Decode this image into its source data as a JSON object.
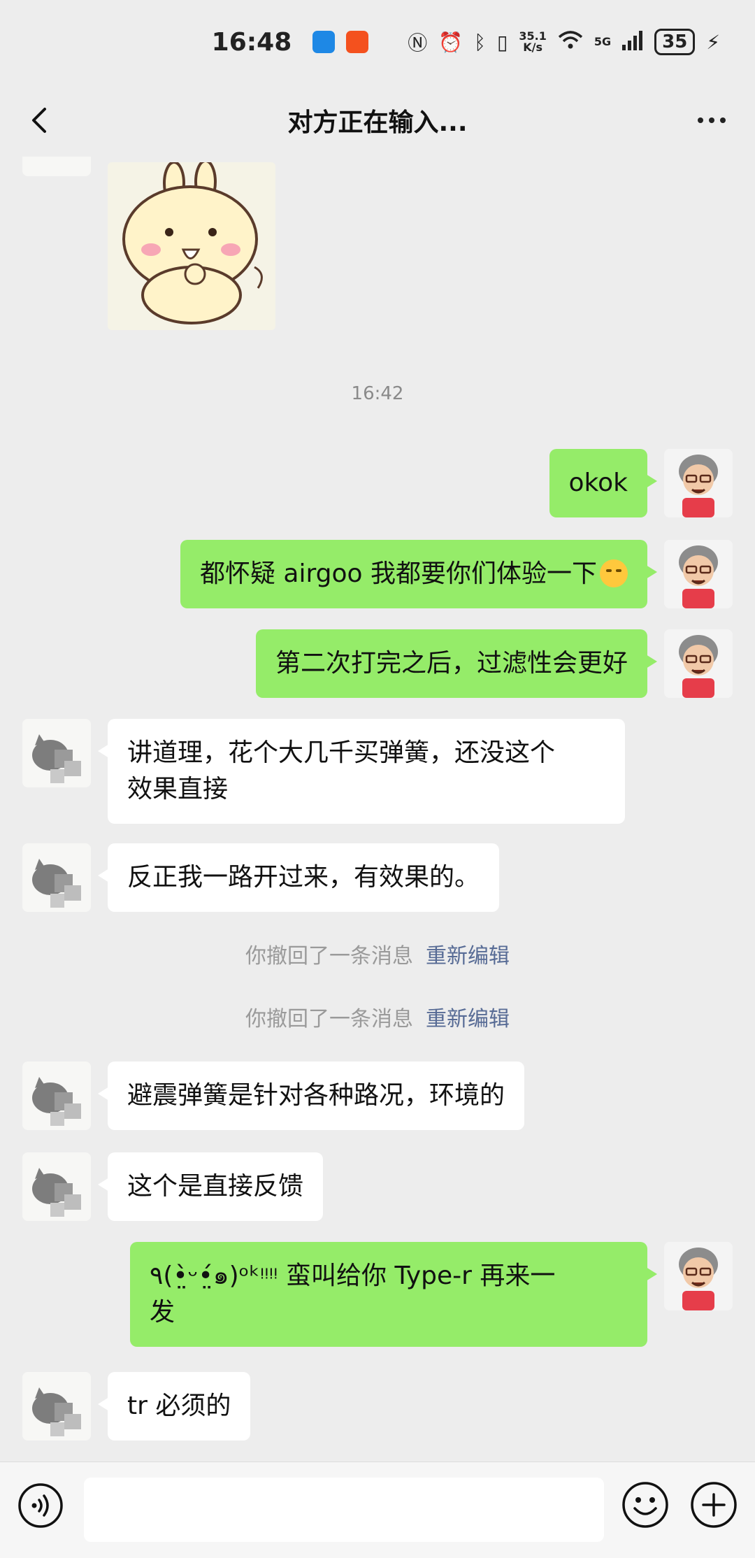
{
  "status_bar": {
    "time": "16:48",
    "net_speed_value": "35.1",
    "net_speed_unit": "K/s",
    "network": "5G",
    "battery": "35"
  },
  "nav": {
    "title": "对方正在输入..."
  },
  "messages": {
    "timestamp": "16:42",
    "m1": "okok",
    "m2": "都怀疑 airgoo 我都要你们体验一下",
    "m3": "第二次打完之后，过滤性会更好",
    "m4_line1": "讲道理，花个大几千买弹簧，还没这个",
    "m4_line2": "效果直接",
    "m5": "反正我一路开过来，有效果的。",
    "recall_text": "你撤回了一条消息",
    "recall_edit": "重新编辑",
    "m6": "避震弹簧是针对各种路况，环境的",
    "m7": "这个是直接反馈",
    "m8_line1": "٩(•̤̀ᵕ•̤́๑)ᵒᵏᵎᵎᵎᵎ 蛮叫给你 Type-r 再来一",
    "m8_line2": "发",
    "m9": "tr 必须的"
  },
  "colors": {
    "background": "#ededed",
    "my_bubble": "#95ec69",
    "their_bubble": "#ffffff",
    "link": "#576b95"
  }
}
